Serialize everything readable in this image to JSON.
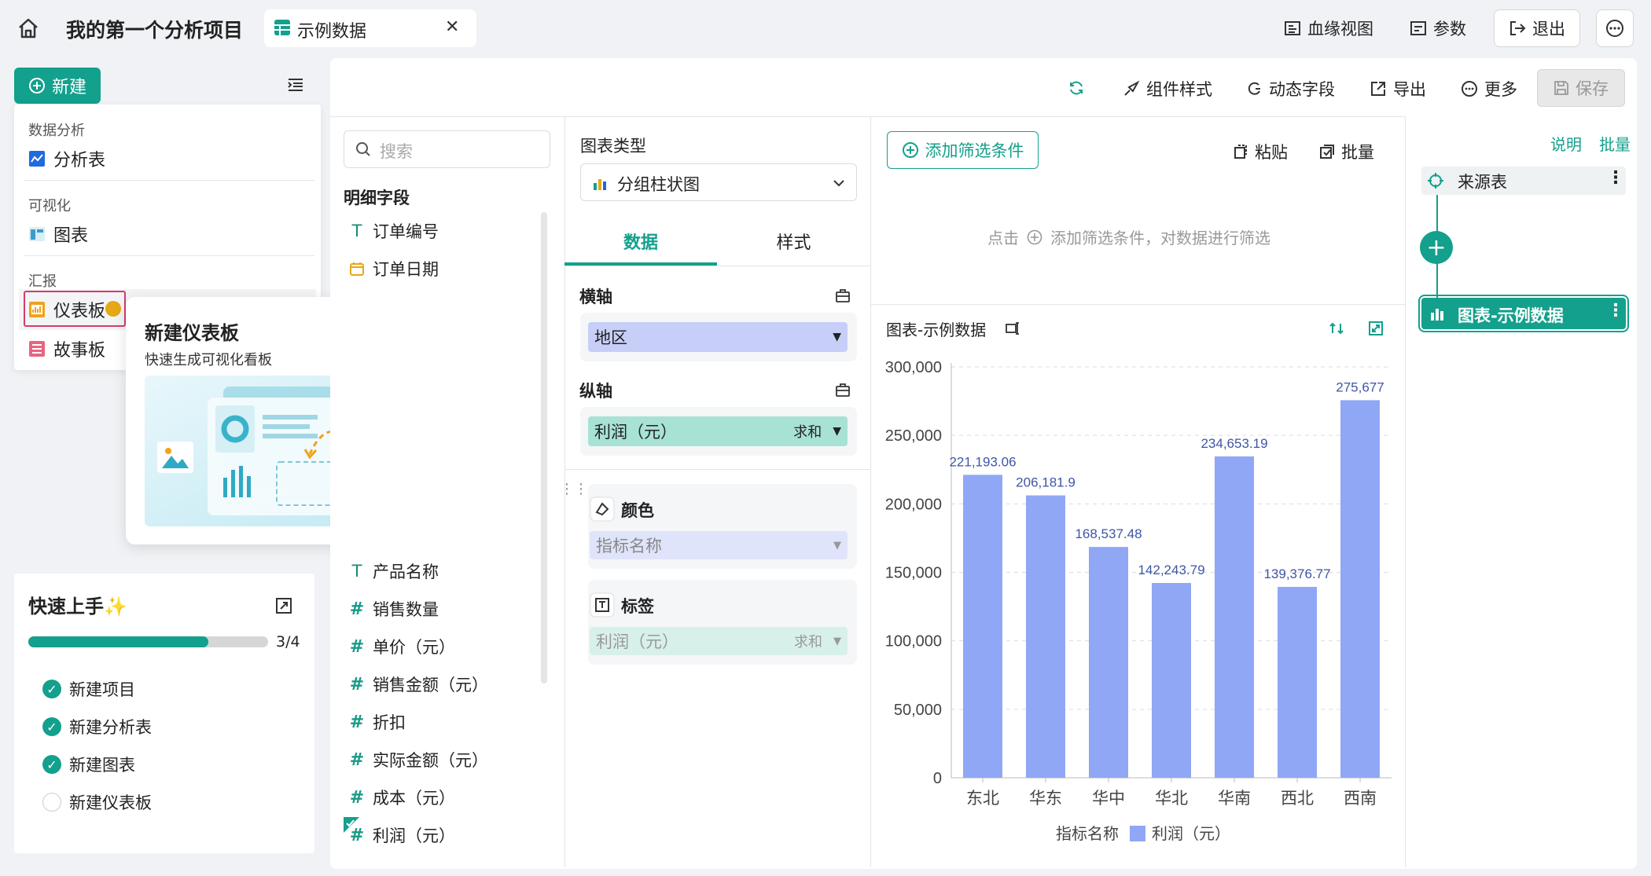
{
  "topbar": {
    "project": "我的第一个分析项目",
    "tab_label": "示例数据",
    "lineage": "血缘视图",
    "params": "参数",
    "exit": "退出"
  },
  "left": {
    "new_label": "新建",
    "menu": {
      "sec1": "数据分析",
      "item1": "分析表",
      "sec2": "可视化",
      "item2": "图表",
      "sec3": "汇报",
      "item3": "仪表板",
      "item4": "故事板"
    },
    "tooltip": {
      "title": "新建仪表板",
      "desc": "快速生成可视化看板"
    },
    "quick": {
      "title": "快速上手✨",
      "progress": 0.75,
      "progress_text": "3/4",
      "items": [
        {
          "label": "新建项目",
          "done": true
        },
        {
          "label": "新建分析表",
          "done": true
        },
        {
          "label": "新建图表",
          "done": true
        },
        {
          "label": "新建仪表板",
          "done": false
        }
      ]
    }
  },
  "toolbar": {
    "style": "组件样式",
    "dynamic": "动态字段",
    "export": "导出",
    "more": "更多",
    "save": "保存"
  },
  "fields": {
    "search_placeholder": "搜索",
    "title": "明细字段",
    "top": [
      {
        "type": "T",
        "label": "订单编号"
      },
      {
        "type": "date",
        "label": "订单日期"
      }
    ],
    "bottom": [
      {
        "type": "T",
        "label": "产品名称"
      },
      {
        "type": "#",
        "label": "销售数量"
      },
      {
        "type": "#",
        "label": "单价（元）"
      },
      {
        "type": "#",
        "label": "销售金额（元）"
      },
      {
        "type": "#",
        "label": "折扣"
      },
      {
        "type": "#",
        "label": "实际金额（元）"
      },
      {
        "type": "#",
        "label": "成本（元）"
      },
      {
        "type": "#",
        "label": "利润（元）"
      }
    ]
  },
  "config": {
    "chart_type_label": "图表类型",
    "chart_type": "分组柱状图",
    "tab_data": "数据",
    "tab_style": "样式",
    "x_axis": "横轴",
    "x_field": "地区",
    "y_axis": "纵轴",
    "y_field": "利润（元）",
    "y_agg": "求和",
    "color": "颜色",
    "color_field": "指标名称",
    "label": "标签",
    "label_field": "利润（元）",
    "label_agg": "求和"
  },
  "filter": {
    "add": "添加筛选条件",
    "paste": "粘贴",
    "batch": "批量",
    "hint_pre": "点击",
    "hint_post": "添加筛选条件，对数据进行筛选"
  },
  "chart_title": "图表-示例数据",
  "chart_data": {
    "type": "bar",
    "categories": [
      "东北",
      "华东",
      "华中",
      "华北",
      "华南",
      "西北",
      "西南"
    ],
    "values": [
      221193.06,
      206181.9,
      168537.48,
      142243.79,
      234653.19,
      139376.77,
      275677
    ],
    "data_labels": [
      "221,193.06",
      "206,181.9",
      "168,537.48",
      "142,243.79",
      "234,653.19",
      "139,376.77",
      "275,677"
    ],
    "y_ticks": [
      "0",
      "50,000",
      "100,000",
      "150,000",
      "200,000",
      "250,000",
      "300,000"
    ],
    "ylim": [
      0,
      300000
    ],
    "legend_title": "指标名称",
    "series_name": "利润（元）",
    "color": "#8fa7f5"
  },
  "flow": {
    "explain": "说明",
    "batch": "批量",
    "source": "来源表",
    "chart": "图表-示例数据"
  }
}
